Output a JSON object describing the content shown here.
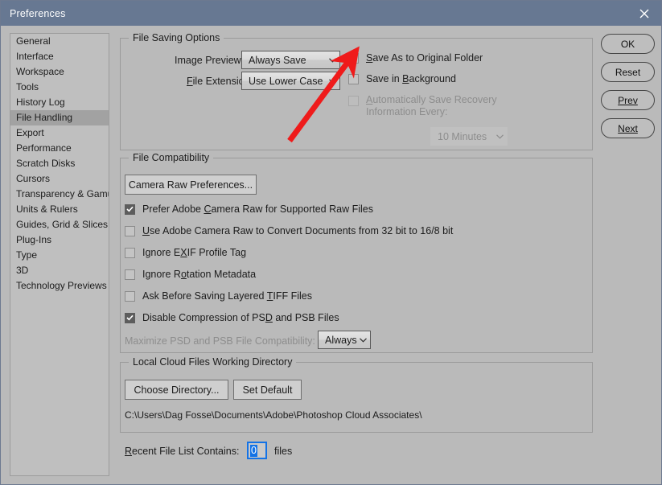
{
  "window": {
    "title": "Preferences",
    "close_icon": "close-icon",
    "titlebar_color": "#677892",
    "background_color": "#bababa"
  },
  "sidebar": {
    "selected": "File Handling",
    "items": [
      {
        "label": "General"
      },
      {
        "label": "Interface"
      },
      {
        "label": "Workspace"
      },
      {
        "label": "Tools"
      },
      {
        "label": "History Log"
      },
      {
        "label": "File Handling"
      },
      {
        "label": "Export"
      },
      {
        "label": "Performance"
      },
      {
        "label": "Scratch Disks"
      },
      {
        "label": "Cursors"
      },
      {
        "label": "Transparency & Gamut"
      },
      {
        "label": "Units & Rulers"
      },
      {
        "label": "Guides, Grid & Slices"
      },
      {
        "label": "Plug-Ins"
      },
      {
        "label": "Type"
      },
      {
        "label": "3D"
      },
      {
        "label": "Technology Previews"
      }
    ]
  },
  "buttons": {
    "ok": "OK",
    "reset": "Reset",
    "prev": "Prev",
    "next": "Next"
  },
  "file_saving_options": {
    "group_title": "File Saving Options",
    "image_previews_label": "Image Previews:",
    "image_previews_value": "Always Save",
    "file_extension_label": "File Extension:",
    "file_extension_value": "Use Lower Case",
    "save_as_original_folder": {
      "label": "Save As to Original Folder",
      "checked": false,
      "enabled": true
    },
    "save_in_background": {
      "label": "Save in Background",
      "checked": false,
      "enabled": true
    },
    "auto_save_recovery": {
      "label_line1": "Automatically Save Recovery",
      "label_line2": "Information Every:",
      "checked": false,
      "enabled": false
    },
    "auto_save_interval_value": "10 Minutes"
  },
  "file_compatibility": {
    "group_title": "File Compatibility",
    "camera_raw_button": "Camera Raw Preferences...",
    "checkboxes": [
      {
        "label": "Prefer Adobe Camera Raw for Supported Raw Files",
        "checked": true
      },
      {
        "label": "Use Adobe Camera Raw to Convert Documents from 32 bit to 16/8 bit",
        "checked": false
      },
      {
        "label": "Ignore EXIF Profile Tag",
        "checked": false
      },
      {
        "label": "Ignore Rotation Metadata",
        "checked": false
      },
      {
        "label": "Ask Before Saving Layered TIFF Files",
        "checked": false
      },
      {
        "label": "Disable Compression of PSD and PSB Files",
        "checked": true
      }
    ],
    "maximize_label": "Maximize PSD and PSB File Compatibility:",
    "maximize_value": "Always"
  },
  "local_cloud": {
    "group_title": "Local Cloud Files Working Directory",
    "choose_directory_button": "Choose Directory...",
    "set_default_button": "Set Default",
    "path": "C:\\Users\\Dag Fosse\\Documents\\Adobe\\Photoshop Cloud Associates\\"
  },
  "recent_files": {
    "label": "Recent File List Contains:",
    "value": "0",
    "suffix": "files",
    "focus_color": "#1473e6"
  },
  "annotation": {
    "type": "arrow",
    "color": "#ef1b1b",
    "points_at": "Save As to Original Folder checkbox"
  }
}
